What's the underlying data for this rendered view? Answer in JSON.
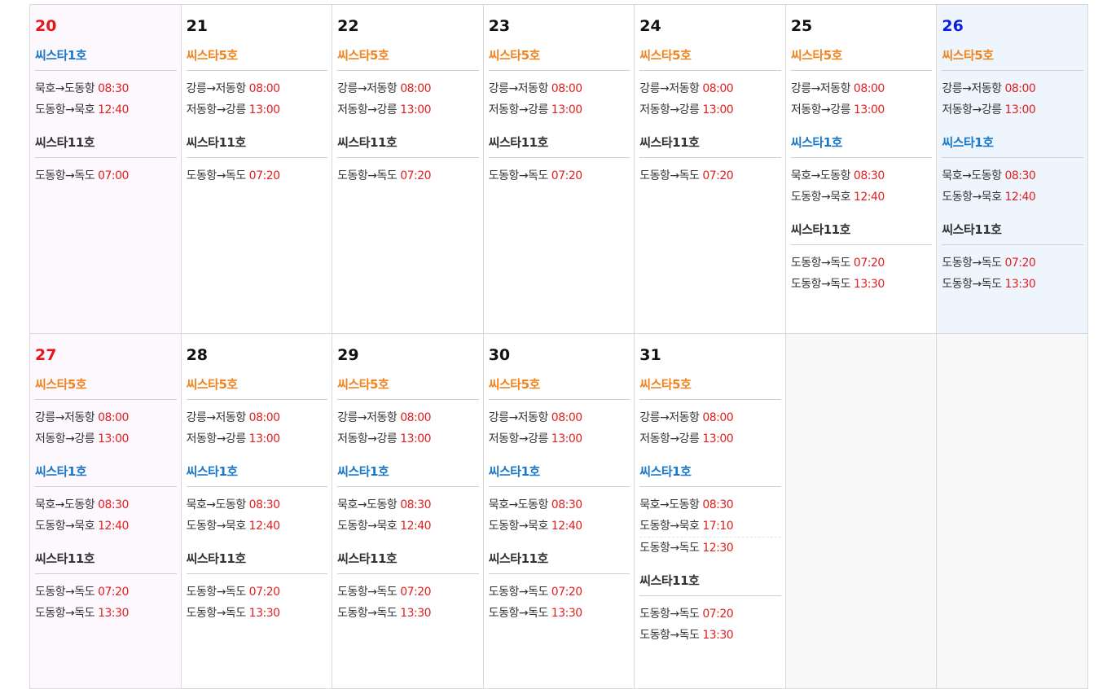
{
  "weeks": [
    [
      {
        "day": "20",
        "type": "sun",
        "ships": [
          {
            "name": "씨스타1호",
            "color": "c1",
            "routes": [
              {
                "route": "묵호→도동항",
                "time": "08:30"
              },
              {
                "route": "도동항→묵호",
                "time": "12:40"
              }
            ]
          },
          {
            "name": "씨스타11호",
            "color": "c11",
            "routes": [
              {
                "route": "도동항→독도",
                "time": "07:00"
              }
            ]
          }
        ]
      },
      {
        "day": "21",
        "type": "",
        "ships": [
          {
            "name": "씨스타5호",
            "color": "c5",
            "routes": [
              {
                "route": "강릉→저동항",
                "time": "08:00"
              },
              {
                "route": "저동항→강릉",
                "time": "13:00"
              }
            ]
          },
          {
            "name": "씨스타11호",
            "color": "c11",
            "routes": [
              {
                "route": "도동항→독도",
                "time": "07:20"
              }
            ]
          }
        ]
      },
      {
        "day": "22",
        "type": "",
        "ships": [
          {
            "name": "씨스타5호",
            "color": "c5",
            "routes": [
              {
                "route": "강릉→저동항",
                "time": "08:00"
              },
              {
                "route": "저동항→강릉",
                "time": "13:00"
              }
            ]
          },
          {
            "name": "씨스타11호",
            "color": "c11",
            "routes": [
              {
                "route": "도동항→독도",
                "time": "07:20"
              }
            ]
          }
        ]
      },
      {
        "day": "23",
        "type": "",
        "ships": [
          {
            "name": "씨스타5호",
            "color": "c5",
            "routes": [
              {
                "route": "강릉→저동항",
                "time": "08:00"
              },
              {
                "route": "저동항→강릉",
                "time": "13:00"
              }
            ]
          },
          {
            "name": "씨스타11호",
            "color": "c11",
            "routes": [
              {
                "route": "도동항→독도",
                "time": "07:20"
              }
            ]
          }
        ]
      },
      {
        "day": "24",
        "type": "",
        "ships": [
          {
            "name": "씨스타5호",
            "color": "c5",
            "routes": [
              {
                "route": "강릉→저동항",
                "time": "08:00"
              },
              {
                "route": "저동항→강릉",
                "time": "13:00"
              }
            ]
          },
          {
            "name": "씨스타11호",
            "color": "c11",
            "routes": [
              {
                "route": "도동항→독도",
                "time": "07:20"
              }
            ]
          }
        ]
      },
      {
        "day": "25",
        "type": "",
        "ships": [
          {
            "name": "씨스타5호",
            "color": "c5",
            "routes": [
              {
                "route": "강릉→저동항",
                "time": "08:00"
              },
              {
                "route": "저동항→강릉",
                "time": "13:00"
              }
            ]
          },
          {
            "name": "씨스타1호",
            "color": "c1",
            "routes": [
              {
                "route": "묵호→도동항",
                "time": "08:30"
              },
              {
                "route": "도동항→묵호",
                "time": "12:40"
              }
            ]
          },
          {
            "name": "씨스타11호",
            "color": "c11",
            "routes": [
              {
                "route": "도동항→독도",
                "time": "07:20"
              },
              {
                "route": "도동항→독도",
                "time": "13:30"
              }
            ]
          }
        ]
      },
      {
        "day": "26",
        "type": "sat",
        "ships": [
          {
            "name": "씨스타5호",
            "color": "c5",
            "routes": [
              {
                "route": "강릉→저동항",
                "time": "08:00"
              },
              {
                "route": "저동항→강릉",
                "time": "13:00"
              }
            ]
          },
          {
            "name": "씨스타1호",
            "color": "c1",
            "routes": [
              {
                "route": "묵호→도동항",
                "time": "08:30"
              },
              {
                "route": "도동항→묵호",
                "time": "12:40"
              }
            ]
          },
          {
            "name": "씨스타11호",
            "color": "c11",
            "routes": [
              {
                "route": "도동항→독도",
                "time": "07:20"
              },
              {
                "route": "도동항→독도",
                "time": "13:30"
              }
            ]
          }
        ]
      }
    ],
    [
      {
        "day": "27",
        "type": "sun",
        "ships": [
          {
            "name": "씨스타5호",
            "color": "c5",
            "routes": [
              {
                "route": "강릉→저동항",
                "time": "08:00"
              },
              {
                "route": "저동항→강릉",
                "time": "13:00"
              }
            ]
          },
          {
            "name": "씨스타1호",
            "color": "c1",
            "routes": [
              {
                "route": "묵호→도동항",
                "time": "08:30"
              },
              {
                "route": "도동항→묵호",
                "time": "12:40"
              }
            ]
          },
          {
            "name": "씨스타11호",
            "color": "c11",
            "routes": [
              {
                "route": "도동항→독도",
                "time": "07:20"
              },
              {
                "route": "도동항→독도",
                "time": "13:30"
              }
            ]
          }
        ]
      },
      {
        "day": "28",
        "type": "",
        "ships": [
          {
            "name": "씨스타5호",
            "color": "c5",
            "routes": [
              {
                "route": "강릉→저동항",
                "time": "08:00"
              },
              {
                "route": "저동항→강릉",
                "time": "13:00"
              }
            ]
          },
          {
            "name": "씨스타1호",
            "color": "c1",
            "routes": [
              {
                "route": "묵호→도동항",
                "time": "08:30"
              },
              {
                "route": "도동항→묵호",
                "time": "12:40"
              }
            ]
          },
          {
            "name": "씨스타11호",
            "color": "c11",
            "routes": [
              {
                "route": "도동항→독도",
                "time": "07:20"
              },
              {
                "route": "도동항→독도",
                "time": "13:30"
              }
            ]
          }
        ]
      },
      {
        "day": "29",
        "type": "",
        "ships": [
          {
            "name": "씨스타5호",
            "color": "c5",
            "routes": [
              {
                "route": "강릉→저동항",
                "time": "08:00"
              },
              {
                "route": "저동항→강릉",
                "time": "13:00"
              }
            ]
          },
          {
            "name": "씨스타1호",
            "color": "c1",
            "routes": [
              {
                "route": "묵호→도동항",
                "time": "08:30"
              },
              {
                "route": "도동항→묵호",
                "time": "12:40"
              }
            ]
          },
          {
            "name": "씨스타11호",
            "color": "c11",
            "routes": [
              {
                "route": "도동항→독도",
                "time": "07:20"
              },
              {
                "route": "도동항→독도",
                "time": "13:30"
              }
            ]
          }
        ]
      },
      {
        "day": "30",
        "type": "",
        "ships": [
          {
            "name": "씨스타5호",
            "color": "c5",
            "routes": [
              {
                "route": "강릉→저동항",
                "time": "08:00"
              },
              {
                "route": "저동항→강릉",
                "time": "13:00"
              }
            ]
          },
          {
            "name": "씨스타1호",
            "color": "c1",
            "routes": [
              {
                "route": "묵호→도동항",
                "time": "08:30"
              },
              {
                "route": "도동항→묵호",
                "time": "12:40"
              }
            ]
          },
          {
            "name": "씨스타11호",
            "color": "c11",
            "routes": [
              {
                "route": "도동항→독도",
                "time": "07:20"
              },
              {
                "route": "도동항→독도",
                "time": "13:30"
              }
            ]
          }
        ]
      },
      {
        "day": "31",
        "type": "",
        "ships": [
          {
            "name": "씨스타5호",
            "color": "c5",
            "routes": [
              {
                "route": "강릉→저동항",
                "time": "08:00"
              },
              {
                "route": "저동항→강릉",
                "time": "13:00"
              }
            ]
          },
          {
            "name": "씨스타1호",
            "color": "c1",
            "routes": [
              {
                "route": "묵호→도동항",
                "time": "08:30"
              },
              {
                "route": "도동항→묵호",
                "time": "17:10"
              },
              {
                "route": "도동항→독도",
                "time": "12:30",
                "dashed": true
              }
            ]
          },
          {
            "name": "씨스타11호",
            "color": "c11",
            "routes": [
              {
                "route": "도동항→독도",
                "time": "07:20"
              },
              {
                "route": "도동항→독도",
                "time": "13:30"
              }
            ]
          }
        ]
      },
      {
        "day": "",
        "type": "empty",
        "ships": []
      },
      {
        "day": "",
        "type": "empty",
        "ships": []
      }
    ]
  ]
}
